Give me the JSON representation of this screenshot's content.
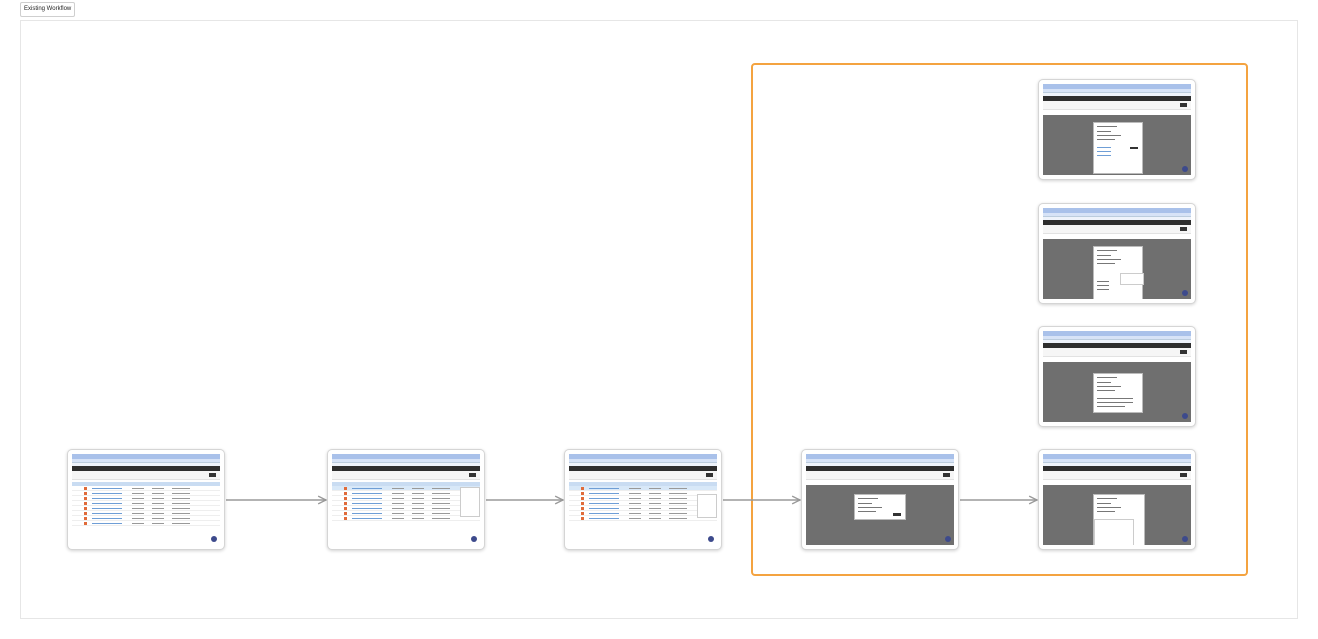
{
  "board": {
    "label": "Existing Workflow"
  },
  "colors": {
    "highlight": "#f4a340",
    "connector": "#9a9a9a",
    "overlay": "#4a4a4a"
  },
  "nodes": [
    {
      "id": "step-1",
      "state": "list view"
    },
    {
      "id": "step-2",
      "state": "row menu open"
    },
    {
      "id": "step-3",
      "state": "row menu open"
    },
    {
      "id": "step-4",
      "state": "dialog open"
    },
    {
      "id": "step-5",
      "state": "dialog with dropdown"
    },
    {
      "id": "step-6",
      "state": "dialog variant"
    },
    {
      "id": "step-7",
      "state": "dialog variant"
    },
    {
      "id": "step-8",
      "state": "dialog variant"
    }
  ],
  "edges": [
    {
      "from": "step-1",
      "to": "step-2"
    },
    {
      "from": "step-2",
      "to": "step-3"
    },
    {
      "from": "step-3",
      "to": "step-4"
    },
    {
      "from": "step-4",
      "to": "step-5"
    }
  ]
}
